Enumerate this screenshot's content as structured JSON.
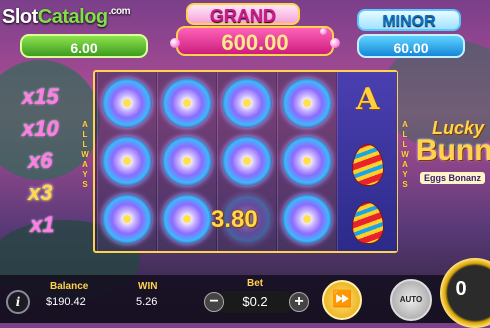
{
  "brand": {
    "name_a": "Slot",
    "name_b": "Catalog",
    "suffix": ".com"
  },
  "jackpots": {
    "mini": {
      "value": "6.00"
    },
    "grand": {
      "title": "GRAND",
      "value": "600.00"
    },
    "minor": {
      "title": "MINOR",
      "value": "60.00"
    }
  },
  "multipliers": [
    {
      "label": "x15",
      "active": false
    },
    {
      "label": "x10",
      "active": false
    },
    {
      "label": "x6",
      "active": false
    },
    {
      "label": "x3",
      "active": true
    },
    {
      "label": "x1",
      "active": false
    }
  ],
  "side_text": {
    "letters": [
      "A",
      "L",
      "L",
      "W",
      "A",
      "Y",
      "S"
    ]
  },
  "reels": {
    "columns": [
      [
        "vortex",
        "vortex",
        "vortex"
      ],
      [
        "vortex",
        "vortex",
        "vortex"
      ],
      [
        "vortex",
        "vortex",
        "vortex"
      ],
      [
        "vortex",
        "vortex",
        "vortex"
      ],
      [
        "A",
        "egg",
        "egg"
      ]
    ],
    "symbol_a": "A",
    "win_amount": "3.80"
  },
  "game_logo": {
    "line1": "Lucky",
    "line2": "Bunn",
    "line3": "Eggs Bonanz"
  },
  "footer": {
    "balance_label": "Balance",
    "balance_value": "$190.42",
    "win_label": "WIN",
    "win_value": "5.26",
    "bet_label": "Bet",
    "bet_value": "$0.2",
    "minus": "−",
    "plus": "+",
    "info": "i",
    "turbo_icon": "⏩",
    "auto_label": "AUTO",
    "spin_value": "0"
  }
}
